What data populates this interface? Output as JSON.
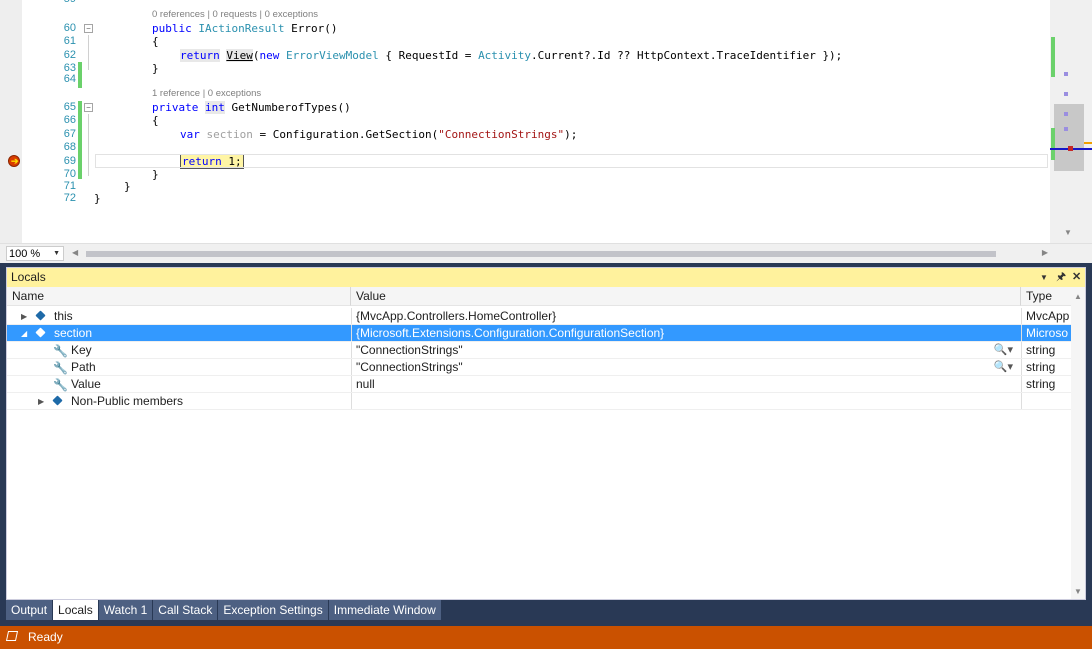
{
  "editor": {
    "partial_line_number": "59",
    "lines": [
      {
        "n": "60",
        "kind": "method1"
      },
      {
        "n": "61",
        "text": "{"
      },
      {
        "n": "62",
        "kind": "return_view"
      },
      {
        "n": "63",
        "text": "}"
      },
      {
        "n": "64",
        "text": ""
      },
      {
        "n": "65",
        "kind": "method2"
      },
      {
        "n": "66",
        "text": "{"
      },
      {
        "n": "67",
        "kind": "var_section"
      },
      {
        "n": "68",
        "text": ""
      },
      {
        "n": "69",
        "kind": "return_one"
      },
      {
        "n": "70",
        "text": "}"
      },
      {
        "n": "71",
        "text": "}"
      },
      {
        "n": "72",
        "text": "}"
      }
    ],
    "lens1": "0 references | 0 requests | 0 exceptions",
    "lens2": "1 reference | 0 exceptions",
    "code": {
      "l60_kw": "public",
      "l60_type": "IActionResult",
      "l60_rest": " Error()",
      "l62_kw": "return",
      "l62_view": "View",
      "l62_paren": "(",
      "l62_new": "new",
      "l62_type": "ErrorViewModel",
      "l62_mid": " { RequestId = ",
      "l62_activity": "Activity",
      "l62_rest": ".Current?.Id ?? HttpContext.TraceIdentifier });",
      "l65_kw": "private",
      "l65_int": "int",
      "l65_rest": " GetNumberofTypes()",
      "l67_var": "var",
      "l67_section": "section",
      "l67_mid": " = Configuration.GetSection(",
      "l67_str": "\"ConnectionStrings\"",
      "l67_end": ");",
      "l69_return": "return",
      "l69_rest": " 1;"
    },
    "zoom": "100 %"
  },
  "locals": {
    "title": "Locals",
    "columns": {
      "name": "Name",
      "value": "Value",
      "type": "Type"
    },
    "rows": [
      {
        "name": "this",
        "value": "{MvcApp.Controllers.HomeController}",
        "type": "MvcApp"
      },
      {
        "name": "section",
        "value": "{Microsoft.Extensions.Configuration.ConfigurationSection}",
        "type": "Microso"
      },
      {
        "name": "Key",
        "value": "\"ConnectionStrings\"",
        "type": "string"
      },
      {
        "name": "Path",
        "value": "\"ConnectionStrings\"",
        "type": "string"
      },
      {
        "name": "Value",
        "value": "null",
        "type": "string"
      },
      {
        "name": "Non-Public members",
        "value": "",
        "type": ""
      }
    ]
  },
  "tabs": [
    "Output",
    "Locals",
    "Watch 1",
    "Call Stack",
    "Exception Settings",
    "Immediate Window"
  ],
  "status": {
    "text": "Ready"
  },
  "colors": {
    "status_bar": "#ca5100",
    "tool_title": "#fff29d",
    "selection": "#3399ff"
  },
  "icons": {
    "breakpoint": "current-statement-arrow-icon",
    "object": "object-icon",
    "property": "wrench-icon",
    "search": "magnifier-icon"
  }
}
